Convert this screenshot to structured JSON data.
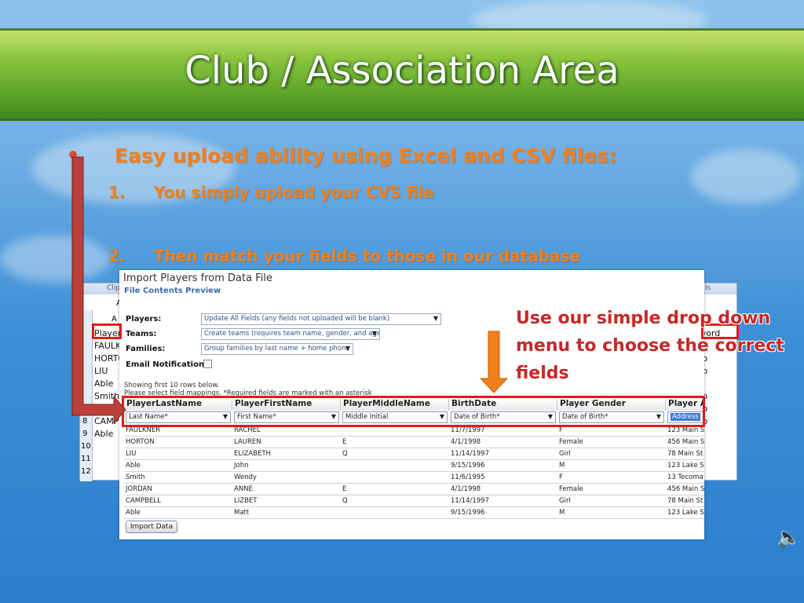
{
  "slide": {
    "title": "Club / Association Area",
    "heading": "Easy upload ability using Excel and CSV files:",
    "items": [
      {
        "num": "1.",
        "text": "You simply upload your CVS file"
      },
      {
        "num": "2.",
        "text": "Then match your fields to those in our database"
      }
    ],
    "callout": "Use our simple drop down menu to choose the correct fields",
    "speaker_icon": "speaker-icon"
  },
  "excel": {
    "ribbon_left": "Clipb",
    "ribbon_right": "ls",
    "col_a_header": "A",
    "col_a_label": "A",
    "rows": [
      {
        "num": "",
        "value": "Playeri"
      },
      {
        "num": "",
        "value": "FAULK"
      },
      {
        "num": "",
        "value": "HORTO"
      },
      {
        "num": "",
        "value": "LIU"
      },
      {
        "num": "",
        "value": "Able"
      },
      {
        "num": "",
        "value": "Smith"
      },
      {
        "num": "",
        "value": ""
      },
      {
        "num": "8",
        "value": "CAMPB"
      },
      {
        "num": "9",
        "value": "Able"
      },
      {
        "num": "10",
        "value": ""
      },
      {
        "num": "11",
        "value": ""
      },
      {
        "num": "12",
        "value": ""
      }
    ],
    "right_col": [
      "assword",
      "emo",
      "emo",
      "emo",
      "emo",
      "emo"
    ]
  },
  "dialog": {
    "title": "Import Players from Data File",
    "subtitle": "File Contents Preview",
    "options": [
      {
        "label": "Players:",
        "value": "Update All Fields (any fields not uploaded will be blank)"
      },
      {
        "label": "Teams:",
        "value": "Create teams (requires team name, gender, and age)"
      },
      {
        "label": "Families:",
        "value": "Group families by last name + home phone"
      },
      {
        "label": "Email Notifications:",
        "value": ""
      }
    ],
    "showing_line1": "Showing first 10 rows below.",
    "showing_line2": "Please select field mappings. *Required fields are marked with an asterisk",
    "columns": [
      {
        "header": "PlayerLastName",
        "mapping": "Last Name*"
      },
      {
        "header": "PlayerFirstName",
        "mapping": "First Name*"
      },
      {
        "header": "PlayerMiddleName",
        "mapping": "Middle Initial"
      },
      {
        "header": "BirthDate",
        "mapping": "Date of Birth*"
      },
      {
        "header": "Player Gender",
        "mapping": "Date of Birth*"
      },
      {
        "header": "Player A",
        "mapping": "Address"
      }
    ],
    "rows": [
      [
        "FAULKNER",
        "RACHEL",
        "",
        "11/7/1997",
        "F",
        "123 Main S"
      ],
      [
        "HORTON",
        "LAUREN",
        "E",
        "4/1/1998",
        "Female",
        "456 Main S"
      ],
      [
        "LIU",
        "ELIZABETH",
        "Q",
        "11/14/1997",
        "Girl",
        "78 Main St"
      ],
      [
        "Able",
        "John",
        "",
        "9/15/1996",
        "M",
        "123 Lake S"
      ],
      [
        "Smith",
        "Wendy",
        "",
        "11/6/1995",
        "F",
        "13 Tecoma"
      ],
      [
        "JORDAN",
        "ANNE",
        "E",
        "4/1/1998",
        "Female",
        "456 Main S"
      ],
      [
        "CAMPBELL",
        "LIZBET",
        "Q",
        "11/14/1997",
        "Girl",
        "78 Main St"
      ],
      [
        "Able",
        "Matt",
        "",
        "9/15/1996",
        "M",
        "123 Lake S"
      ]
    ],
    "import_button": "Import Data"
  },
  "colors": {
    "title_band": "#5fa62b",
    "accent_orange": "#f0801e",
    "callout_red": "#c62828",
    "highlight_red": "#e01b1b"
  }
}
